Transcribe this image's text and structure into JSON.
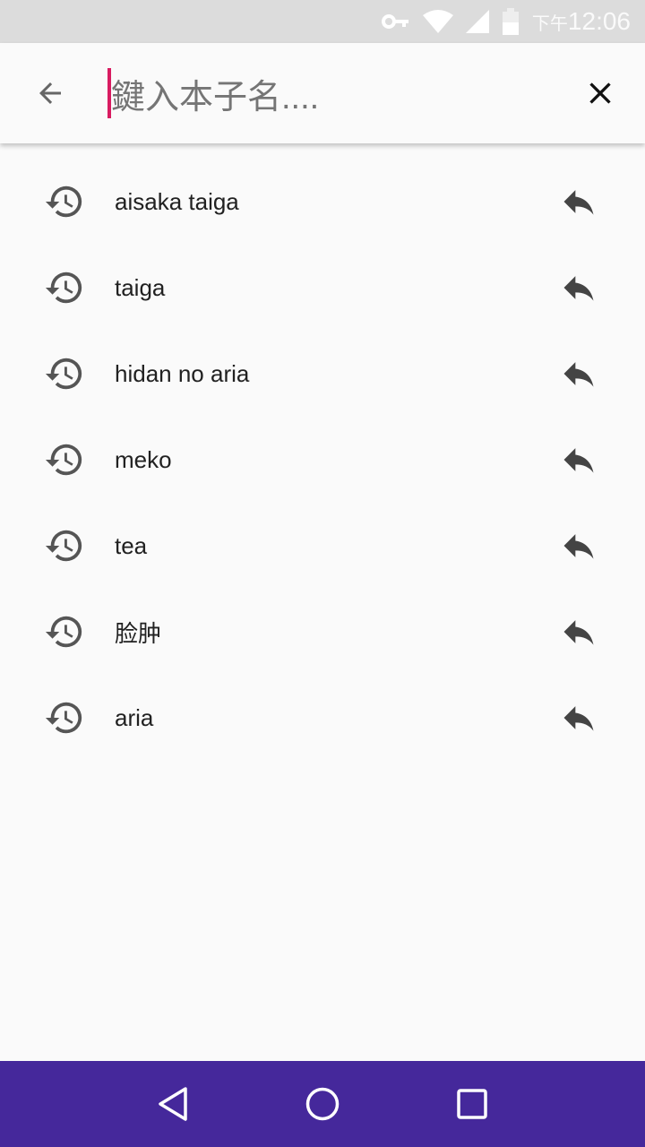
{
  "status_bar": {
    "time_prefix": "下午",
    "time": "12:06",
    "icons": [
      "vpn-key-icon",
      "wifi-icon",
      "signal-icon",
      "battery-icon"
    ]
  },
  "search": {
    "placeholder": "鍵入本子名....",
    "cursor_color": "#d81b60",
    "back_icon": "arrow-back-icon",
    "clear_icon": "close-icon"
  },
  "history": [
    {
      "label": "aisaka taiga"
    },
    {
      "label": "taiga"
    },
    {
      "label": "hidan no aria"
    },
    {
      "label": "meko"
    },
    {
      "label": "tea"
    },
    {
      "label": "脸肿"
    },
    {
      "label": "aria"
    }
  ],
  "nav_bar": {
    "color": "#45289b",
    "buttons": [
      "back",
      "home",
      "recents"
    ]
  }
}
